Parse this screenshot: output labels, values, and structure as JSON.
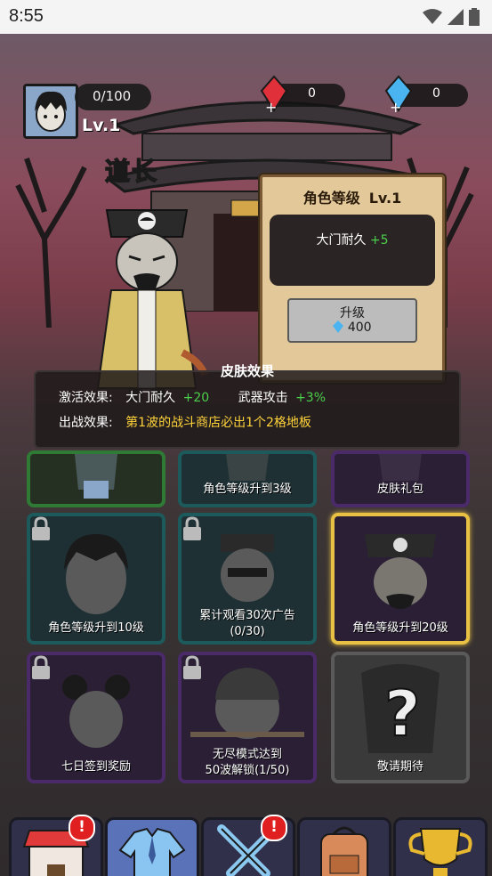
{
  "status_bar": {
    "time": "8:55"
  },
  "hud": {
    "xp": "0/100",
    "level": "Lv.1",
    "red_gems": "0",
    "blue_gems": "0"
  },
  "character": {
    "name": "道长"
  },
  "upgrade_panel": {
    "title": "角色等级",
    "level": "Lv.1",
    "stat_label": "大门耐久",
    "stat_value": "+5",
    "button_label": "升级",
    "cost": "400"
  },
  "skin_effect": {
    "title": "皮肤效果",
    "activate_label": "激活效果:",
    "activate_stat1": "大门耐久",
    "activate_val1": "+20",
    "activate_stat2": "武器攻击",
    "activate_val2": "+3%",
    "battle_label": "出战效果:",
    "battle_text": "第1波的战斗商店必出1个2格地板"
  },
  "cards": [
    {
      "label": "",
      "sub": "",
      "border": "green"
    },
    {
      "label": "角色等级升到3级",
      "sub": "",
      "border": "teal"
    },
    {
      "label": "皮肤礼包",
      "sub": "",
      "border": "purple"
    },
    {
      "label": "角色等级升到10级",
      "sub": "",
      "border": "teal"
    },
    {
      "label": "累计观看30次广告",
      "sub": "(0/30)",
      "border": "teal"
    },
    {
      "label": "角色等级升到20级",
      "sub": "",
      "border": "gold"
    },
    {
      "label": "七日签到奖励",
      "sub": "",
      "border": "purple"
    },
    {
      "label": "无尽模式达到",
      "sub": "50波解锁(1/50)",
      "border": "purple"
    },
    {
      "label": "敬请期待",
      "sub": "",
      "border": "gray"
    }
  ],
  "nav": [
    {
      "label": "商城",
      "badge": "!"
    },
    {
      "label": "角色",
      "badge": ""
    },
    {
      "label": "战斗",
      "badge": "!"
    },
    {
      "label": "武器",
      "badge": ""
    },
    {
      "label": "活动",
      "badge": ""
    }
  ],
  "colors": {
    "accent_gold": "#e8c043",
    "bonus_green": "#4bd04b",
    "highlight_yellow": "#ffd43a",
    "active_nav": "#5a73b8"
  }
}
